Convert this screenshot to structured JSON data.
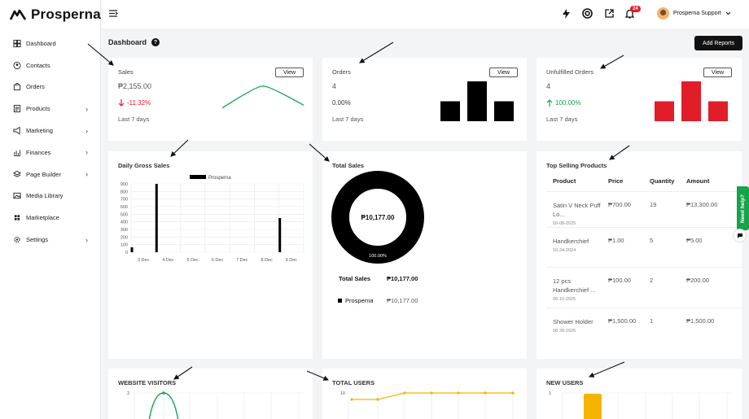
{
  "brand": {
    "name": "Prosperna"
  },
  "sidebar": {
    "items": [
      {
        "label": "Dashboard",
        "icon": "dashboard-icon",
        "chevron": false
      },
      {
        "label": "Contacts",
        "icon": "contacts-icon",
        "chevron": false
      },
      {
        "label": "Orders",
        "icon": "bag-icon",
        "chevron": false
      },
      {
        "label": "Products",
        "icon": "products-icon",
        "chevron": true
      },
      {
        "label": "Marketing",
        "icon": "megaphone-icon",
        "chevron": true
      },
      {
        "label": "Finances",
        "icon": "finances-icon",
        "chevron": true
      },
      {
        "label": "Page Builder",
        "icon": "layers-icon",
        "chevron": true
      },
      {
        "label": "Media Library",
        "icon": "media-icon",
        "chevron": false
      },
      {
        "label": "Marketplace",
        "icon": "marketplace-icon",
        "chevron": false
      },
      {
        "label": "Settings",
        "icon": "gear-icon",
        "chevron": true
      }
    ]
  },
  "topbar": {
    "notification_count": "24",
    "user_name": "Prosperna Support"
  },
  "page": {
    "title": "Dashboard",
    "add_reports_label": "Add Reports"
  },
  "cards": {
    "sales": {
      "title": "Sales",
      "view_label": "View",
      "value": "₱2,155.00",
      "delta": "-11.32%",
      "period": "Last 7 days"
    },
    "orders": {
      "title": "Orders",
      "view_label": "View",
      "value": "4",
      "delta": "0.00%",
      "period": "Last 7 days"
    },
    "unfulfilled": {
      "title": "Unfulfilled Orders",
      "view_label": "View",
      "value": "4",
      "delta": "100.00%",
      "period": "Last 7 days"
    },
    "daily_gross": {
      "title": "Daily Gross Sales"
    },
    "total_sales": {
      "title": "Total Sales",
      "center_value": "₱10,177.00",
      "ring_label": "100.00%",
      "summary_label": "Total Sales",
      "summary_value": "₱10,177.00",
      "legend_label": "Prosperna",
      "legend_value": "₱10,177.00"
    },
    "top_products": {
      "title": "Top Selling Products",
      "columns": [
        "Product",
        "Price",
        "Quantity",
        "Amount"
      ],
      "rows": [
        {
          "product": "Satin V Neck Puff Lo...",
          "date": "09-08-2025",
          "price": "₱700.00",
          "qty": "19",
          "amount": "₱13,300.00"
        },
        {
          "product": "Handkerchief",
          "date": "10-24-2024",
          "price": "₱1.00",
          "qty": "5",
          "amount": "₱5.00"
        },
        {
          "product": "12 pcs Handkerchief ...",
          "date": "09-15-2025",
          "price": "₱100.00",
          "qty": "2",
          "amount": "₱200.00"
        },
        {
          "product": "Shower Holder",
          "date": "08-28-2025",
          "price": "₱1,500.00",
          "qty": "1",
          "amount": "₱1,500.00"
        }
      ]
    },
    "visitors": {
      "title": "WEBSITE VISITORS"
    },
    "total_users": {
      "title": "TOTAL USERS"
    },
    "new_users": {
      "title": "NEW USERS"
    }
  },
  "help": {
    "tab_label": "Need help?"
  },
  "colors": {
    "green": "#16a34a",
    "red": "#e11d2a",
    "orange": "#f5b400",
    "black": "#000000"
  },
  "chart_data": [
    {
      "type": "line",
      "x": [
        1,
        2,
        3
      ],
      "values": [
        20,
        60,
        25
      ],
      "title": "",
      "note": "sales sparkline (no axes)",
      "color": "#16a34a"
    },
    {
      "type": "bar",
      "categories": [
        "1",
        "2",
        "3"
      ],
      "values": [
        1,
        2,
        1
      ],
      "title": "",
      "color": "#000000"
    },
    {
      "type": "bar",
      "categories": [
        "1",
        "2",
        "3"
      ],
      "values": [
        1,
        2,
        1
      ],
      "title": "",
      "color": "#e11d2a"
    },
    {
      "type": "bar",
      "title": "Daily Gross Sales",
      "categories": [
        "3 Dec",
        "4 Dec",
        "5 Dec",
        "6 Dec",
        "7 Dec",
        "8 Dec",
        "9 Dec"
      ],
      "series": [
        {
          "name": "Prosperna",
          "values": [
            [
              "2025-12-03",
              65
            ],
            [
              "2025-12-04",
              900
            ],
            [
              "2025-12-09",
              450
            ]
          ]
        }
      ],
      "yticks": [
        "0",
        "100",
        "200",
        "300",
        "400",
        "500",
        "600",
        "700",
        "800",
        "900"
      ],
      "ylim": [
        0,
        900
      ],
      "grid": true,
      "legend": "top"
    },
    {
      "type": "pie",
      "title": "Total Sales",
      "slices": [
        {
          "name": "Prosperna",
          "value": 10177.0,
          "percent": 100.0
        }
      ],
      "donut": true
    },
    {
      "type": "line",
      "title": "WEBSITE VISITORS",
      "ytick_top": "2",
      "peak": 2,
      "color": "#16a34a"
    },
    {
      "type": "line",
      "title": "TOTAL USERS",
      "values": [
        9,
        9,
        10,
        10,
        10,
        10,
        10
      ],
      "ytick_top": "10",
      "color": "#f5b400"
    },
    {
      "type": "bar",
      "title": "NEW USERS",
      "ytick_top": "1",
      "values": [
        1
      ],
      "color": "#f5b400"
    }
  ]
}
